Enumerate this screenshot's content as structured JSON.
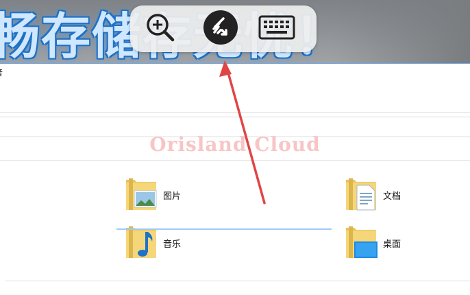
{
  "banner": {
    "text": "畅存储存无忧！"
  },
  "toolbar": {
    "buttons": [
      {
        "name": "zoom",
        "icon": "zoom-in-icon"
      },
      {
        "name": "connect",
        "icon": "remote-desktop-icon"
      },
      {
        "name": "keyboard",
        "icon": "keyboard-icon"
      }
    ]
  },
  "window": {
    "title": "音"
  },
  "watermark": "Orisland Cloud",
  "folders": [
    {
      "label": "图片",
      "icon": "pictures-folder-icon"
    },
    {
      "label": "文档",
      "icon": "documents-folder-icon"
    },
    {
      "label": "音乐",
      "icon": "music-folder-icon"
    },
    {
      "label": "桌面",
      "icon": "desktop-folder-icon"
    }
  ],
  "annotation": {
    "arrow_color": "#e04545"
  }
}
